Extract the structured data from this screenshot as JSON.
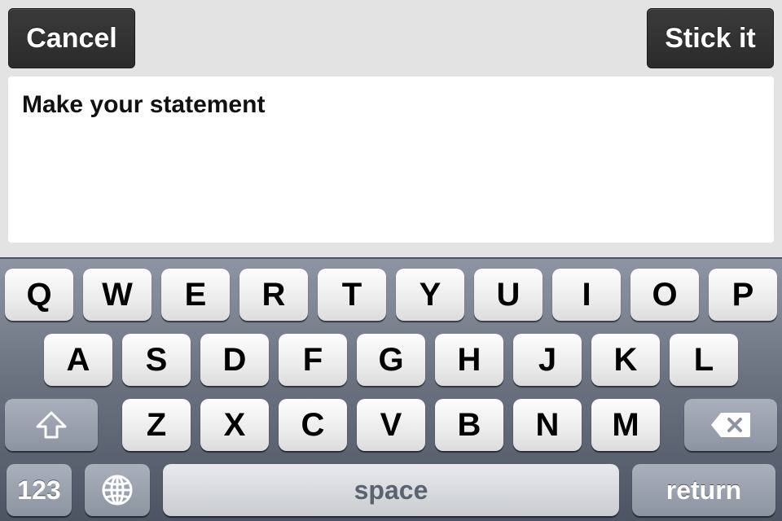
{
  "header": {
    "cancel_label": "Cancel",
    "submit_label": "Stick it"
  },
  "statement": {
    "placeholder": "Make your statement"
  },
  "keyboard": {
    "row1": [
      "Q",
      "W",
      "E",
      "R",
      "T",
      "Y",
      "U",
      "I",
      "O",
      "P"
    ],
    "row2": [
      "A",
      "S",
      "D",
      "F",
      "G",
      "H",
      "J",
      "K",
      "L"
    ],
    "row3": [
      "Z",
      "X",
      "C",
      "V",
      "B",
      "N",
      "M"
    ],
    "numbers_label": "123",
    "space_label": "space",
    "return_label": "return",
    "icons": {
      "shift": "shift-icon",
      "delete": "backspace-icon",
      "globe": "globe-icon"
    }
  }
}
